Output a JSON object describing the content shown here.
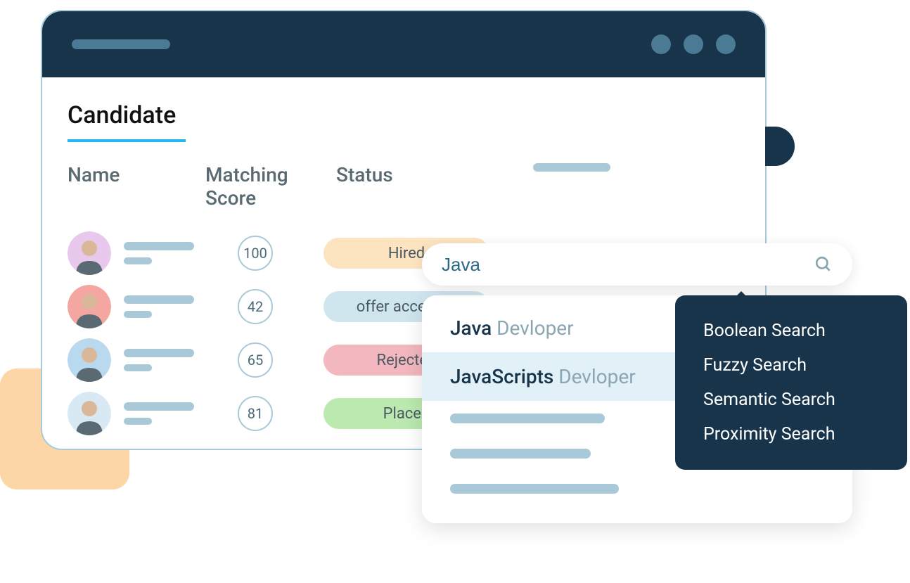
{
  "page": {
    "title": "Candidate"
  },
  "columns": {
    "name": "Name",
    "score": "Matching Score",
    "status": "Status"
  },
  "candidates": [
    {
      "score": "100",
      "status": "Hired",
      "status_class": "pill-hired",
      "avatar_bg": "#e9c8ee"
    },
    {
      "score": "42",
      "status": "offer accepted",
      "status_class": "pill-offer",
      "avatar_bg": "#f3a7a0"
    },
    {
      "score": "65",
      "status": "Rejected",
      "status_class": "pill-rejected",
      "avatar_bg": "#b9d9ee"
    },
    {
      "score": "81",
      "status": "Placed",
      "status_class": "pill-placed",
      "avatar_bg": "#d9e9f3"
    }
  ],
  "search": {
    "value": "Java"
  },
  "suggestions": [
    {
      "match": "Java",
      "rest": " Devloper",
      "highlighted": false
    },
    {
      "match": "JavaScripts",
      "rest": " Devloper",
      "highlighted": true
    }
  ],
  "search_types": [
    "Boolean Search",
    "Fuzzy Search",
    "Semantic Search",
    "Proximity Search"
  ]
}
